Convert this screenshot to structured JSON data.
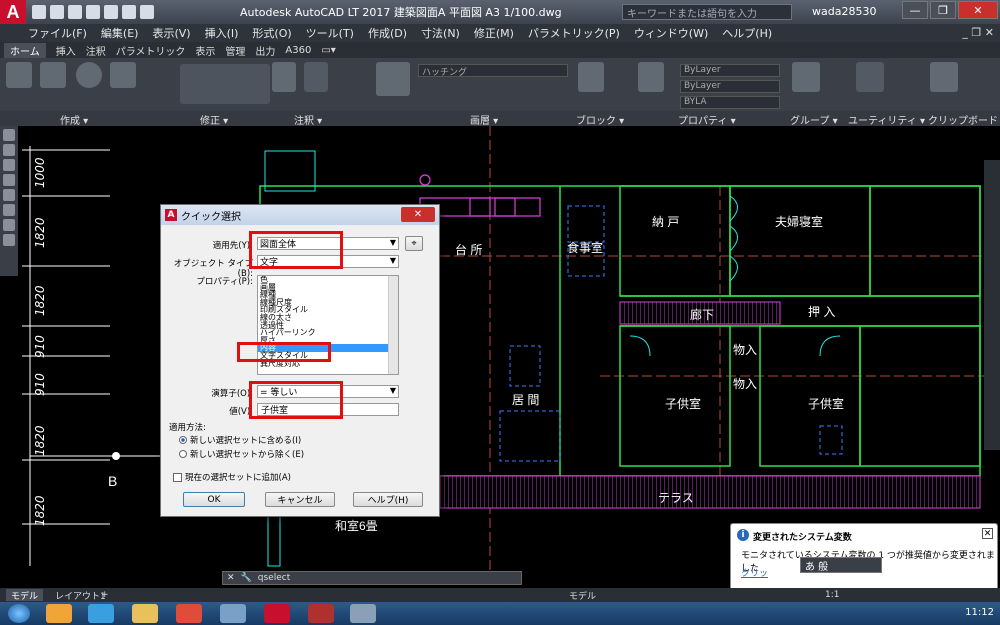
{
  "titlebar": {
    "app_letter": "A",
    "title": "Autodesk AutoCAD LT 2017   建築図面A  平面図 A3  1/100.dwg",
    "search_placeholder": "キーワードまたは語句を入力",
    "user": "wada28530",
    "minimize": "—",
    "restore": "❐",
    "close": "✕"
  },
  "menubar": {
    "items": [
      "ファイル(F)",
      "編集(E)",
      "表示(V)",
      "挿入(I)",
      "形式(O)",
      "ツール(T)",
      "作成(D)",
      "寸法(N)",
      "修正(M)",
      "パラメトリック(P)",
      "ウィンドウ(W)",
      "ヘルプ(H)"
    ],
    "right": "_ ❐ ✕"
  },
  "ribbon_tabs": [
    "ホーム",
    "挿入",
    "注釈",
    "パラメトリック",
    "表示",
    "管理",
    "出力",
    "A360",
    "▭▾"
  ],
  "ribbon_panels": [
    "作成 ▾",
    "修正 ▾",
    "注釈 ▾",
    "画層 ▾",
    "ブロック ▾",
    "プロパティ ▾",
    "グループ ▾",
    "ユーティリティ ▾",
    "クリップボード"
  ],
  "ribbon_combos": {
    "layer": "ハッチング",
    "bylayer1": "ByLayer",
    "bylayer2": "ByLayer",
    "bylayer3": "BYLA"
  },
  "drawing": {
    "dims": [
      "1000",
      "1820",
      "1820",
      "910",
      "910",
      "1820",
      "1820"
    ],
    "rooms": [
      "台 所",
      "食事室",
      "納 戸",
      "夫婦寝室",
      "廊下",
      "押 入",
      "物入",
      "物入",
      "子供室",
      "子供室",
      "居 間",
      "テラス",
      "和室6畳"
    ],
    "grid_label": "B"
  },
  "dialog": {
    "title": "クイック選択",
    "apply_to_label": "適用先(Y):",
    "apply_to_value": "図面全体",
    "object_type_label": "オブジェクト タイプ(B):",
    "object_type_value": "文字",
    "properties_label": "プロパティ(P):",
    "properties": [
      "色",
      "画層",
      "線種",
      "線種尺度",
      "印刷スタイル",
      "線の太さ",
      "透過性",
      "ハイパーリンク",
      "厚さ",
      "内容",
      "文字スタイル",
      "異尺度対応"
    ],
    "selected_property": "内容",
    "operator_label": "演算子(O):",
    "operator_value": "= 等しい",
    "value_label": "値(V):",
    "value_value": "子供室",
    "how_to_apply": "適用方法:",
    "radio_include": "新しい選択セットに含める(I)",
    "radio_exclude": "新しい選択セットから除く(E)",
    "append_check": "現在の選択セットに追加(A)",
    "ok": "OK",
    "cancel": "キャンセル",
    "help": "ヘルプ(H)"
  },
  "notification": {
    "title": "変更されたシステム変数",
    "body": "モニタされているシステム変数の 1 つが推奨値から変更されました",
    "link": "クリッ",
    "close": "✕"
  },
  "ime": "あ 般",
  "command_line": {
    "text": "qselect"
  },
  "statusbar": {
    "tab_model": "モデル",
    "tab_layout": "レイアウト1",
    "add": "+",
    "right_model": "モデル",
    "scale": "1:1"
  },
  "taskbar": {
    "clock": "11:12"
  }
}
